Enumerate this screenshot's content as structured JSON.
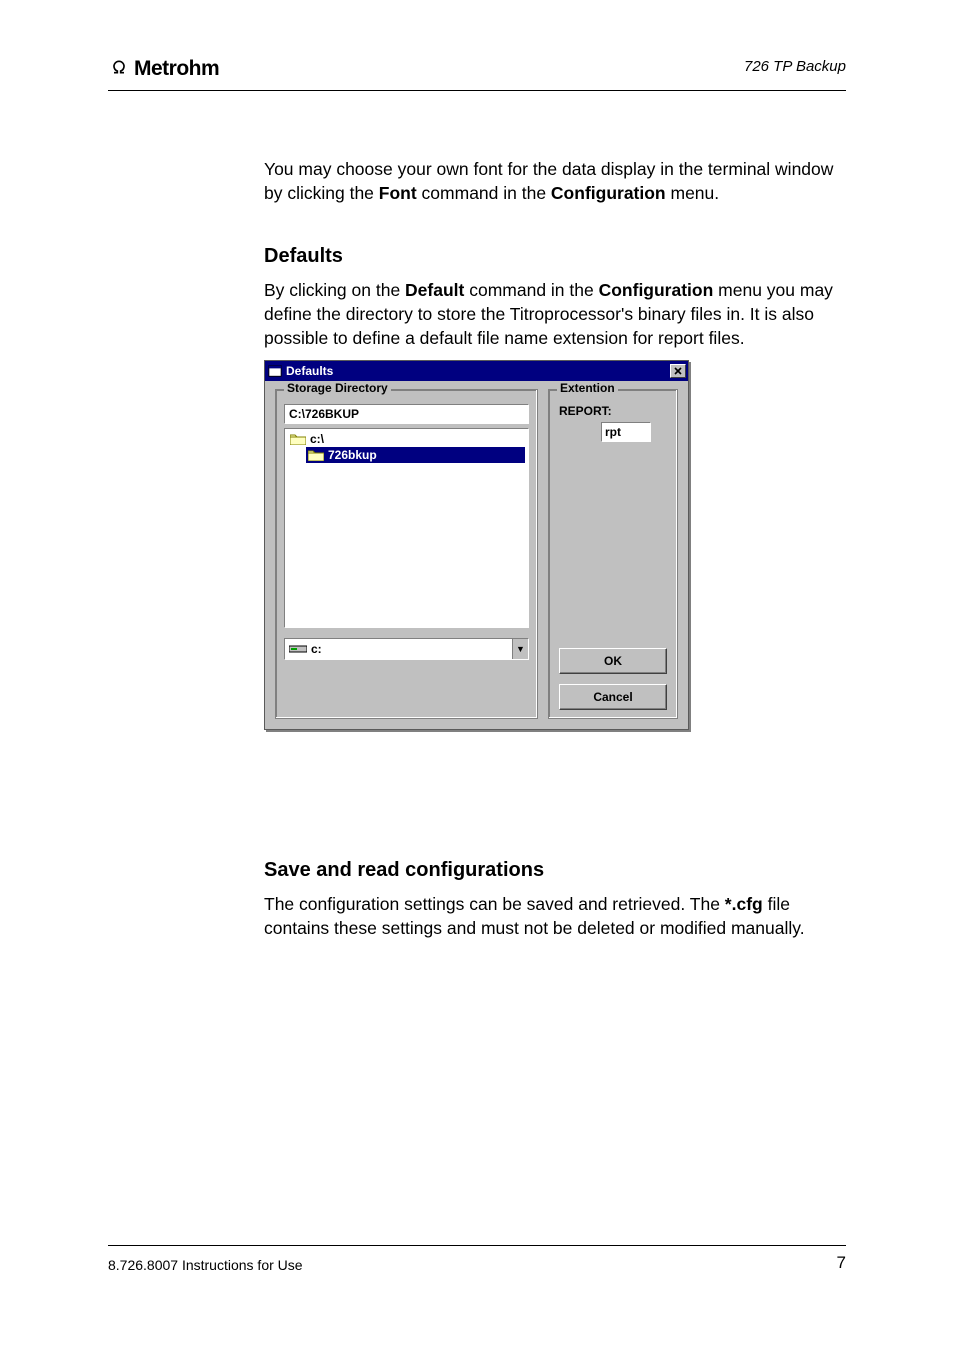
{
  "header": {
    "chapter": "726 TP Backup",
    "logo_text": "Metrohm"
  },
  "body": {
    "para1_a": "You may choose your own font for the data display in the terminal window by clicking the ",
    "para1_b": "Font",
    "para1_c": " command in the ",
    "para1_d": "Configuration",
    "para1_e": " menu.",
    "heading_defaults": "Defaults",
    "para2_a": "By clicking on the ",
    "para2_b": "Default",
    "para2_c": " command in the ",
    "para2_d": "Configuration",
    "para2_e": " menu you may define the directory to store the Titroprocessor's binary files in. It is also possible to define a default file name extension for report files.",
    "heading_save": "Save and read configurations",
    "para3_a": "The configuration settings can be saved and retrieved. The ",
    "para3_b": "*.cfg",
    "para3_c": " file contains these settings and must not be deleted or modified manually."
  },
  "dialog": {
    "title": "Defaults",
    "group_storage": "Storage Directory",
    "group_ext": "Extention",
    "path_value": "C:\\726BKUP",
    "tree_root": "c:\\",
    "tree_child": "726bkup",
    "ext_label": "REPORT:",
    "ext_value": "rpt",
    "ok": "OK",
    "cancel": "Cancel",
    "drive": "c:"
  },
  "footer": {
    "left": "8.726.8007 Instructions for Use",
    "page": "7"
  }
}
